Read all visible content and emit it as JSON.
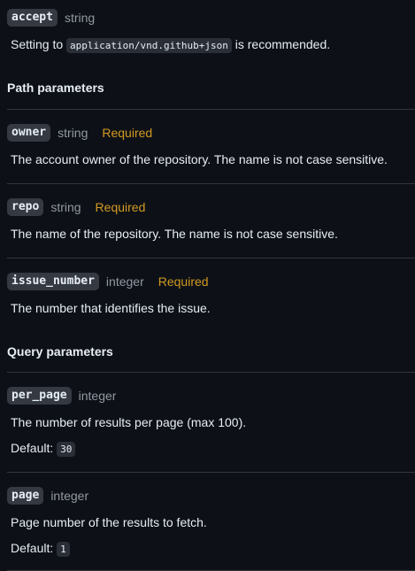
{
  "header_params": {
    "accept": {
      "name": "accept",
      "type": "string",
      "desc_prefix": "Setting to",
      "code": "application/vnd.github+json",
      "desc_suffix": "is recommended."
    }
  },
  "path_section": {
    "heading": "Path parameters",
    "params": [
      {
        "name": "owner",
        "type": "string",
        "required": "Required",
        "description": "The account owner of the repository. The name is not case sensitive."
      },
      {
        "name": "repo",
        "type": "string",
        "required": "Required",
        "description": "The name of the repository. The name is not case sensitive."
      },
      {
        "name": "issue_number",
        "type": "integer",
        "required": "Required",
        "description": "The number that identifies the issue."
      }
    ]
  },
  "query_section": {
    "heading": "Query parameters",
    "params": [
      {
        "name": "per_page",
        "type": "integer",
        "description": "The number of results per page (max 100).",
        "default_label": "Default:",
        "default_value": "30"
      },
      {
        "name": "page",
        "type": "integer",
        "description": "Page number of the results to fetch.",
        "default_label": "Default:",
        "default_value": "1"
      }
    ]
  }
}
